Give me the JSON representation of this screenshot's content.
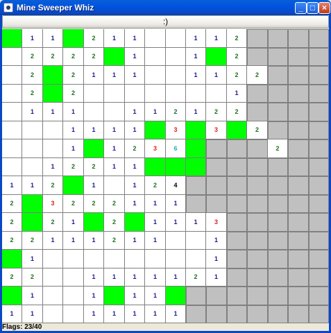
{
  "window": {
    "title": "Mine Sweeper Whiz",
    "minimize_glyph": "_",
    "maximize_glyph": "□",
    "close_glyph": "×",
    "app_icon": "java-cup-icon"
  },
  "toolbar": {
    "face_label": ":)"
  },
  "colors": {
    "flag": "#00ff00",
    "hidden": "#c0c0c0",
    "revealed": "#ffffff",
    "number_1": "#1a1a8c",
    "number_2": "#1f6f1f",
    "number_3": "#e02020",
    "number_4": "#000000",
    "number_6": "#20b0b0"
  },
  "board": {
    "columns": 16,
    "rows": 16,
    "legend": "F = flagged, H = hidden, '.' = revealed empty, digit = revealed number",
    "cells": [
      [
        "F",
        "1",
        "1",
        "F",
        "2",
        "1",
        "1",
        ".",
        ".",
        "1",
        "1",
        "2",
        "H",
        "H",
        "H",
        "H"
      ],
      [
        ".",
        "2",
        "2",
        "2",
        "2",
        "F",
        "1",
        ".",
        ".",
        "1",
        "F",
        "2",
        "H",
        "H",
        "H",
        "H"
      ],
      [
        ".",
        "2",
        "F",
        "2",
        "1",
        "1",
        "1",
        ".",
        ".",
        "1",
        "1",
        "2",
        "2",
        "H",
        "H",
        "H"
      ],
      [
        ".",
        "2",
        "F",
        "2",
        ".",
        ".",
        ".",
        ".",
        ".",
        ".",
        ".",
        "1",
        "H",
        "H",
        "H",
        "H"
      ],
      [
        ".",
        "1",
        "1",
        "1",
        ".",
        ".",
        "1",
        "1",
        "2",
        "1",
        "2",
        "2",
        "H",
        "H",
        "H",
        "H"
      ],
      [
        ".",
        ".",
        ".",
        "1",
        "1",
        "1",
        "1",
        "F",
        "3",
        "F",
        "3",
        "F",
        "2",
        "H",
        "H",
        "H"
      ],
      [
        ".",
        ".",
        ".",
        "1",
        "F",
        "1",
        "2",
        "3",
        "6",
        "F",
        "H",
        "H",
        "H",
        "2",
        "H",
        "H"
      ],
      [
        ".",
        ".",
        "1",
        "2",
        "2",
        "1",
        "1",
        "F",
        "F",
        "F",
        "H",
        "H",
        "H",
        "H",
        "H",
        "H"
      ],
      [
        "1",
        "1",
        "2",
        "F",
        "1",
        ".",
        "1",
        "2",
        "4",
        "H",
        "H",
        "H",
        "H",
        "H",
        "H",
        "H"
      ],
      [
        "2",
        "F",
        "3",
        "2",
        "2",
        "2",
        "1",
        "1",
        "1",
        "H",
        "H",
        "H",
        "H",
        "H",
        "H",
        "H"
      ],
      [
        "2",
        "F",
        "2",
        "1",
        "F",
        "2",
        "F",
        "1",
        "1",
        "1",
        "3",
        "H",
        "H",
        "H",
        "H",
        "H"
      ],
      [
        "2",
        "2",
        "1",
        "1",
        "1",
        "2",
        "1",
        "1",
        ".",
        ".",
        "1",
        "H",
        "H",
        "H",
        "H",
        "H"
      ],
      [
        "F",
        "1",
        ".",
        ".",
        ".",
        ".",
        ".",
        ".",
        ".",
        ".",
        "1",
        "H",
        "H",
        "H",
        "H",
        "H"
      ],
      [
        "2",
        "2",
        ".",
        ".",
        "1",
        "1",
        "1",
        "1",
        "1",
        "2",
        "1",
        "H",
        "H",
        "H",
        "H",
        "H"
      ],
      [
        "F",
        "1",
        ".",
        ".",
        "1",
        "F",
        "1",
        "1",
        "F",
        "H",
        "H",
        "H",
        "H",
        "H",
        "H",
        "H"
      ],
      [
        "1",
        "1",
        ".",
        ".",
        "1",
        "1",
        "1",
        "1",
        "1",
        "H",
        "H",
        "H",
        "H",
        "H",
        "H",
        "H"
      ]
    ]
  },
  "status": {
    "text": "Flags: 23/40"
  }
}
